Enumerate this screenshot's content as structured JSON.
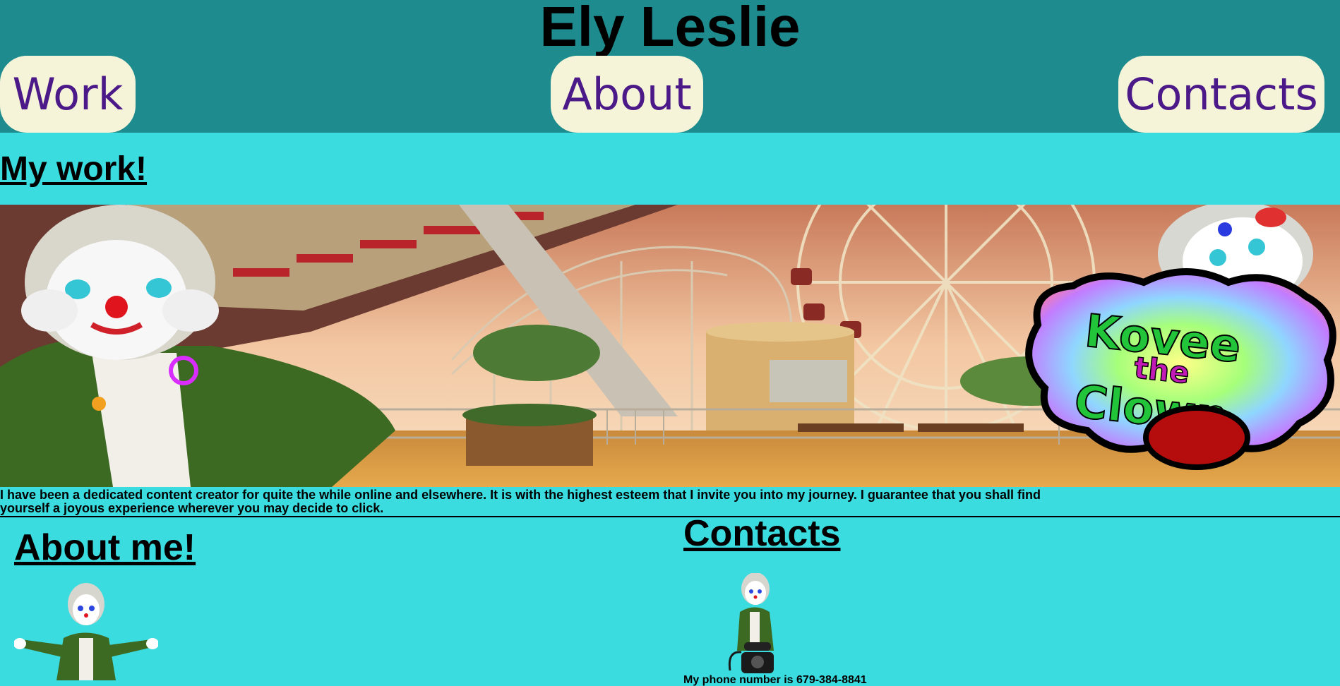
{
  "header": {
    "title": "Ely Leslie",
    "nav": {
      "work": "Work",
      "about": "About",
      "contacts": "Contacts"
    }
  },
  "work": {
    "heading": "My work!",
    "banner_logo": "Kovee the Clown",
    "intro": "I have been a dedicated content creator for quite the while online and elsewhere. It is with the highest esteem that I invite you into my journey. I guarantee that you shall find yourself a joyous experience wherever you may decide to click."
  },
  "about": {
    "heading": "About me!"
  },
  "contacts": {
    "heading": "Contacts",
    "partial_line": "My phone number is 679-384-8841"
  },
  "colors": {
    "header_bg": "#1e8c8e",
    "page_bg": "#3bdcdf",
    "nav_bg": "#f6f4d8",
    "nav_text": "#4b1a88"
  }
}
